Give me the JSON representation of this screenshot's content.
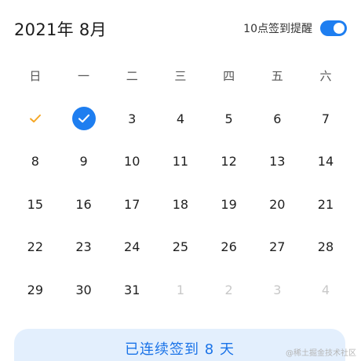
{
  "header": {
    "month_title": "2021年 8月",
    "reminder_label": "10点签到提醒",
    "reminder_on": true
  },
  "weekdays": [
    "日",
    "一",
    "二",
    "三",
    "四",
    "五",
    "六"
  ],
  "calendar": {
    "weeks": [
      [
        {
          "label": "",
          "state": "checked-past"
        },
        {
          "label": "",
          "state": "checked-today"
        },
        {
          "label": "3",
          "state": "normal"
        },
        {
          "label": "4",
          "state": "normal"
        },
        {
          "label": "5",
          "state": "normal"
        },
        {
          "label": "6",
          "state": "normal"
        },
        {
          "label": "7",
          "state": "normal"
        }
      ],
      [
        {
          "label": "8",
          "state": "normal"
        },
        {
          "label": "9",
          "state": "normal"
        },
        {
          "label": "10",
          "state": "normal"
        },
        {
          "label": "11",
          "state": "normal"
        },
        {
          "label": "12",
          "state": "normal"
        },
        {
          "label": "13",
          "state": "normal"
        },
        {
          "label": "14",
          "state": "normal"
        }
      ],
      [
        {
          "label": "15",
          "state": "normal"
        },
        {
          "label": "16",
          "state": "normal"
        },
        {
          "label": "17",
          "state": "normal"
        },
        {
          "label": "18",
          "state": "normal"
        },
        {
          "label": "19",
          "state": "normal"
        },
        {
          "label": "20",
          "state": "normal"
        },
        {
          "label": "21",
          "state": "normal"
        }
      ],
      [
        {
          "label": "22",
          "state": "normal"
        },
        {
          "label": "23",
          "state": "normal"
        },
        {
          "label": "24",
          "state": "normal"
        },
        {
          "label": "25",
          "state": "normal"
        },
        {
          "label": "26",
          "state": "normal"
        },
        {
          "label": "27",
          "state": "normal"
        },
        {
          "label": "28",
          "state": "normal"
        }
      ],
      [
        {
          "label": "29",
          "state": "normal"
        },
        {
          "label": "30",
          "state": "normal"
        },
        {
          "label": "31",
          "state": "normal"
        },
        {
          "label": "1",
          "state": "muted"
        },
        {
          "label": "2",
          "state": "muted"
        },
        {
          "label": "3",
          "state": "muted"
        },
        {
          "label": "4",
          "state": "muted"
        }
      ]
    ]
  },
  "icons": {
    "past_check": "check-mark-icon",
    "today_check": "check-circle-icon"
  },
  "streak": {
    "text": "已连续签到 8 天"
  },
  "watermark": "@稀土掘金技术社区",
  "colors": {
    "accent": "#1e7ef0",
    "past_check": "#f5a623",
    "streak_bg": "#e3effd",
    "streak_text": "#1a73e8",
    "muted_day": "#c8c8c8"
  }
}
